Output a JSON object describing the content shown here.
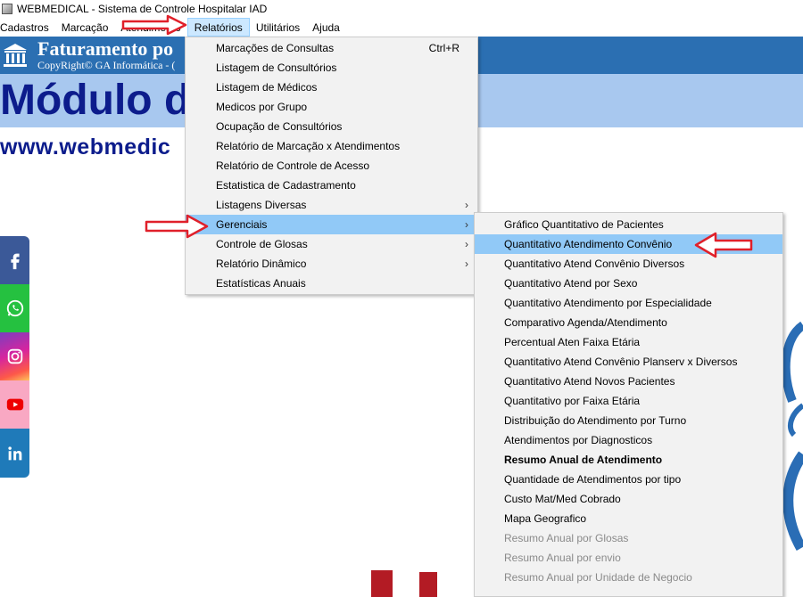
{
  "window": {
    "title": "WEBMEDICAL - Sistema de Controle Hospitalar IAD"
  },
  "menubar": [
    {
      "label": "Cadastros"
    },
    {
      "label": "Marcação"
    },
    {
      "label": "Atendimento"
    },
    {
      "label": "Relatórios"
    },
    {
      "label": "Utilitários"
    },
    {
      "label": "Ajuda"
    }
  ],
  "banner": {
    "title": "Faturamento po",
    "copyright": "CopyRight© GA Informática - ("
  },
  "module": {
    "title": "Módulo d"
  },
  "website": "www.webmedic",
  "social": [
    "facebook-icon",
    "whatsapp-icon",
    "instagram-icon",
    "youtube-icon",
    "linkedin-icon"
  ],
  "relatorios_menu": [
    {
      "label": "Marcações de Consultas",
      "shortcut": "Ctrl+R"
    },
    {
      "label": "Listagem de Consultórios"
    },
    {
      "label": "Listagem de Médicos"
    },
    {
      "label": "Medicos por Grupo"
    },
    {
      "label": "Ocupação de Consultórios"
    },
    {
      "label": "Relatório de Marcação x Atendimentos"
    },
    {
      "label": "Relatório de Controle de Acesso"
    },
    {
      "label": "Estatistica de Cadastramento"
    },
    {
      "label": "Listagens Diversas",
      "submenu": true
    },
    {
      "label": "Gerenciais",
      "submenu": true,
      "highlighted": true
    },
    {
      "label": "Controle de Glosas",
      "submenu": true
    },
    {
      "label": "Relatório Dinâmico",
      "submenu": true
    },
    {
      "label": "Estatísticas Anuais"
    }
  ],
  "gerenciais_menu": [
    {
      "label": "Gráfico Quantitativo de Pacientes"
    },
    {
      "label": "Quantitativo Atendimento Convênio",
      "highlighted": true
    },
    {
      "label": "Quantitativo Atend Convênio Diversos"
    },
    {
      "label": "Quantitativo Atend por Sexo"
    },
    {
      "label": "Quantitativo Atendimento por Especialidade"
    },
    {
      "label": "Comparativo Agenda/Atendimento"
    },
    {
      "label": "Percentual Aten Faixa Etária"
    },
    {
      "label": "Quantitativo Atend Convênio Planserv x Diversos"
    },
    {
      "label": "Quantitativo Atend Novos Pacientes"
    },
    {
      "label": "Quantitativo por Faixa Etária"
    },
    {
      "label": "Distribuição do Atendimento por Turno"
    },
    {
      "label": "Atendimentos por Diagnosticos"
    },
    {
      "label": "Resumo Anual de Atendimento",
      "bold": true
    },
    {
      "label": "Quantidade de Atendimentos por tipo"
    },
    {
      "label": "Custo Mat/Med Cobrado"
    },
    {
      "label": "Mapa Geografico"
    },
    {
      "label": "Resumo Anual por Glosas",
      "disabled": true
    },
    {
      "label": "Resumo Anual por envio",
      "disabled": true
    },
    {
      "label": "Resumo Anual por Unidade de Negocio",
      "disabled": true
    }
  ],
  "colors": {
    "banner": "#2b6fb2",
    "module_band": "#a8c8ef",
    "heading_text": "#0c1c8c",
    "menu_highlight": "#91c9f7",
    "annotation_arrow": "#e0202a"
  }
}
